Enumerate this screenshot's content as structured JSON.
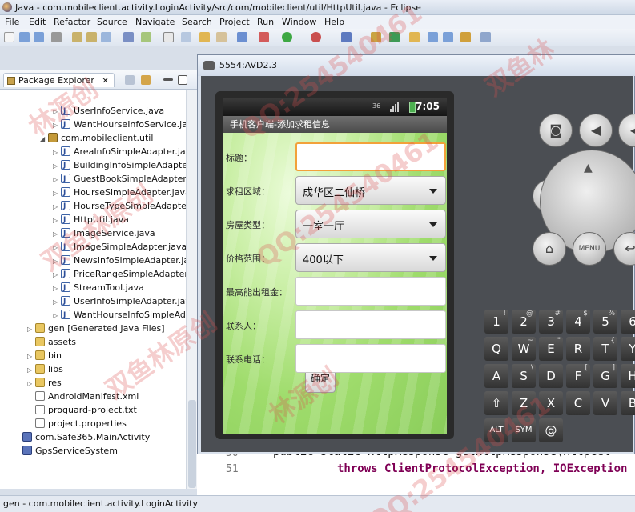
{
  "window": {
    "title": "Java - com.mobileclient.activity.LoginActivity/src/com/mobileclient/util/HttpUtil.java - Eclipse"
  },
  "menu": [
    "File",
    "Edit",
    "Refactor",
    "Source",
    "Navigate",
    "Search",
    "Project",
    "Run",
    "Window",
    "Help"
  ],
  "package_explorer": {
    "tab_label": "Package Explorer",
    "rows": [
      {
        "label": "UserInfoService.java",
        "type": "java",
        "indent": 68,
        "twisty": "▷"
      },
      {
        "label": "WantHourseInfoService.jav",
        "type": "java",
        "indent": 68,
        "twisty": "▷"
      },
      {
        "label": "com.mobileclient.util",
        "type": "package",
        "indent": 52,
        "twisty": "◢"
      },
      {
        "label": "AreaInfoSimpleAdapter.jav",
        "type": "java",
        "indent": 68,
        "twisty": "▷"
      },
      {
        "label": "BuildingInfoSimpleAdapte",
        "type": "java",
        "indent": 68,
        "twisty": "▷"
      },
      {
        "label": "GuestBookSimpleAdapter.",
        "type": "java",
        "indent": 68,
        "twisty": "▷"
      },
      {
        "label": "HourseSimpleAdapter.java",
        "type": "java",
        "indent": 68,
        "twisty": "▷"
      },
      {
        "label": "HourseTypeSimpleAdapte",
        "type": "java",
        "indent": 68,
        "twisty": "▷"
      },
      {
        "label": "HttpUtil.java",
        "type": "java",
        "indent": 68,
        "twisty": "▷"
      },
      {
        "label": "ImageService.java",
        "type": "java",
        "indent": 68,
        "twisty": "▷"
      },
      {
        "label": "ImageSimpleAdapter.java",
        "type": "java",
        "indent": 68,
        "twisty": "▷"
      },
      {
        "label": "NewsInfoSimpleAdapter.ja",
        "type": "java",
        "indent": 68,
        "twisty": "▷"
      },
      {
        "label": "PriceRangeSimpleAdapter",
        "type": "java",
        "indent": 68,
        "twisty": "▷"
      },
      {
        "label": "StreamTool.java",
        "type": "java",
        "indent": 68,
        "twisty": "▷"
      },
      {
        "label": "UserInfoSimpleAdapter.jav",
        "type": "java",
        "indent": 68,
        "twisty": "▷"
      },
      {
        "label": "WantHourseInfoSimpleAd",
        "type": "java",
        "indent": 68,
        "twisty": "▷"
      },
      {
        "label": "gen [Generated Java Files]",
        "type": "folder",
        "indent": 36,
        "twisty": "▷"
      },
      {
        "label": "assets",
        "type": "folder",
        "indent": 36,
        "twisty": ""
      },
      {
        "label": "bin",
        "type": "folder",
        "indent": 36,
        "twisty": "▷"
      },
      {
        "label": "libs",
        "type": "folder",
        "indent": 36,
        "twisty": "▷"
      },
      {
        "label": "res",
        "type": "folder",
        "indent": 36,
        "twisty": "▷"
      },
      {
        "label": "AndroidManifest.xml",
        "type": "xml",
        "indent": 36,
        "twisty": ""
      },
      {
        "label": "proguard-project.txt",
        "type": "xml",
        "indent": 36,
        "twisty": ""
      },
      {
        "label": "project.properties",
        "type": "xml",
        "indent": 36,
        "twisty": ""
      },
      {
        "label": "com.Safe365.MainActivity",
        "type": "project",
        "indent": 20,
        "twisty": ""
      },
      {
        "label": "GpsServiceSystem",
        "type": "project",
        "indent": 20,
        "twisty": ""
      }
    ]
  },
  "emulator": {
    "title": "5554:AVD2.3",
    "status": {
      "time": "7:05",
      "network": "36"
    },
    "app_title": "手机客户端-添加求租信息",
    "form": [
      {
        "label": "标题：",
        "kind": "input",
        "value": "",
        "focused": true
      },
      {
        "label": "求租区域：",
        "kind": "spinner",
        "value": "成华区二仙桥"
      },
      {
        "label": "房屋类型：",
        "kind": "spinner",
        "value": "一室一厅"
      },
      {
        "label": "价格范围：",
        "kind": "spinner",
        "value": "400以下"
      },
      {
        "label": "最高能出租金：",
        "kind": "input",
        "value": ""
      },
      {
        "label": "联系人：",
        "kind": "input",
        "value": ""
      },
      {
        "label": "联系电话：",
        "kind": "input",
        "value": ""
      }
    ],
    "submit_label": "确定",
    "menu_key": "MENU",
    "keyboard": {
      "row1": [
        {
          "k": "1",
          "s": "!"
        },
        {
          "k": "2",
          "s": "@"
        },
        {
          "k": "3",
          "s": "#"
        },
        {
          "k": "4",
          "s": "$"
        },
        {
          "k": "5",
          "s": "%"
        },
        {
          "k": "6",
          "s": ""
        }
      ],
      "row2": [
        {
          "k": "Q",
          "s": ""
        },
        {
          "k": "W",
          "s": "~"
        },
        {
          "k": "E",
          "s": "\""
        },
        {
          "k": "R",
          "s": ""
        },
        {
          "k": "T",
          "s": "{"
        },
        {
          "k": "Y",
          "s": "}"
        }
      ],
      "row3": [
        {
          "k": "A",
          "s": ""
        },
        {
          "k": "S",
          "s": "\\"
        },
        {
          "k": "D",
          "s": ""
        },
        {
          "k": "F",
          "s": "["
        },
        {
          "k": "G",
          "s": "]"
        },
        {
          "k": "H",
          "s": ""
        }
      ],
      "row4": [
        {
          "k": "⇧",
          "s": ""
        },
        {
          "k": "Z",
          "s": ""
        },
        {
          "k": "X",
          "s": ""
        },
        {
          "k": "C",
          "s": ""
        },
        {
          "k": "V",
          "s": ""
        },
        {
          "k": "B",
          "s": ""
        }
      ],
      "row5": [
        {
          "k": "ALT",
          "s": ""
        },
        {
          "k": "SYM",
          "s": ""
        },
        {
          "k": "@",
          "s": ""
        }
      ]
    }
  },
  "editor": {
    "line50": "50",
    "line51": "51",
    "code50": "public static HttpResponse getHttpResponse(HttpGet",
    "code51": "throws ClientProtocolException, IOException"
  },
  "status_text": "gen - com.mobileclient.activity.LoginActivity",
  "watermarks": [
    "林源创",
    "QQ:254540461",
    "双鱼林原创",
    "QQ:254540461",
    "双鱼林原创",
    "林源创",
    "QQ:254540461",
    "双鱼林"
  ]
}
